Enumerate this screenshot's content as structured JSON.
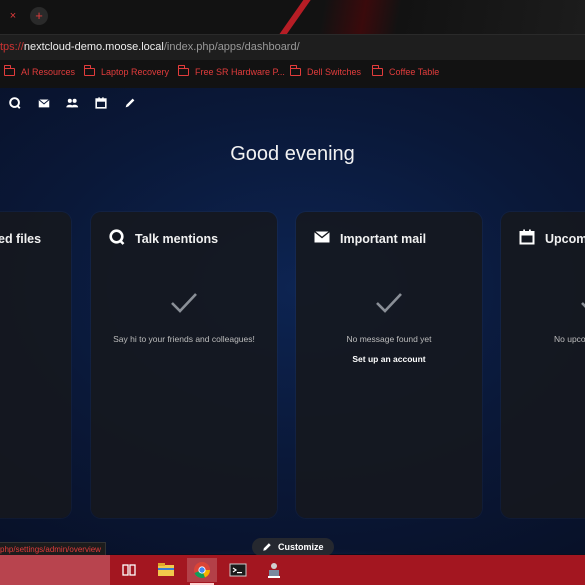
{
  "browser": {
    "tab_close_glyph": "×",
    "new_tab_glyph": "+",
    "url_scheme": "tps://",
    "url_host": "nextcloud-demo.moose.local",
    "url_path": "/index.php/apps/dashboard/",
    "bookmarks": [
      {
        "label": "AI Resources",
        "icon": "folder-icon"
      },
      {
        "label": "Laptop Recovery",
        "icon": "folder-icon"
      },
      {
        "label": "Free SR Hardware P...",
        "icon": "folder-icon"
      },
      {
        "label": "Dell Switches",
        "icon": "folder-icon"
      },
      {
        "label": "Coffee Table",
        "icon": "folder-icon"
      }
    ],
    "status_url": "php/settings/admin/overview",
    "accent_color": "#e23c3c"
  },
  "nav": {
    "icons": [
      "talk-icon",
      "mail-icon",
      "contacts-icon",
      "calendar-icon",
      "notes-icon"
    ]
  },
  "dashboard": {
    "greeting": "Good evening",
    "customize_label": "Customize",
    "cards": [
      {
        "title": "ed files",
        "icon": "file-icon",
        "empty": ""
      },
      {
        "title": "Talk mentions",
        "icon": "talk-icon",
        "empty": "Say hi to your friends and colleagues!"
      },
      {
        "title": "Important mail",
        "icon": "mail-icon",
        "empty": "No message found yet",
        "action": "Set up an account"
      },
      {
        "title": "Upcom",
        "icon": "calendar-icon",
        "empty": "No upco"
      }
    ]
  },
  "taskbar": {
    "icons": [
      "task-view-icon",
      "file-explorer-icon",
      "chrome-icon",
      "terminal-icon",
      "user-app-icon"
    ],
    "active_index": 2
  }
}
